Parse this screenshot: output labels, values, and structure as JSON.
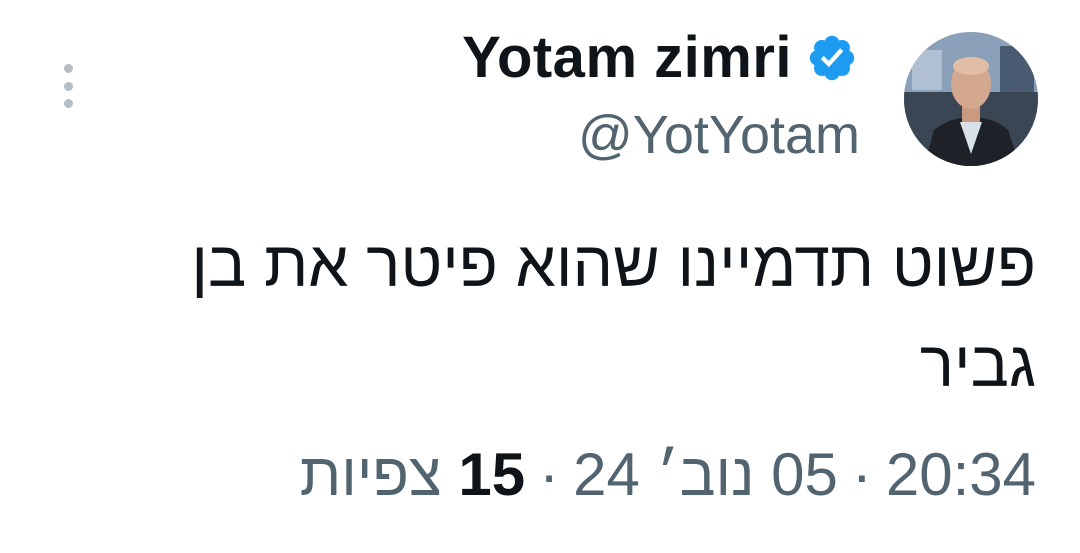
{
  "author": {
    "display_name": "Yotam zimri",
    "handle": "@YotYotam",
    "verified_badge_icon": "verified-badge-icon",
    "avatar_icon": "avatar-photo"
  },
  "menu": {
    "icon": "more-vertical-icon"
  },
  "tweet": {
    "text": "פשוט תדמיינו שהוא פיטר את בן גביר"
  },
  "meta": {
    "time": "20:34",
    "date": "05 נוב׳ 24",
    "separator": "·",
    "views_count": "15",
    "views_label": "צפיות"
  },
  "colors": {
    "text_primary": "#0f1419",
    "text_secondary": "#536471",
    "verified_blue": "#1d9bf0",
    "background": "#ffffff"
  }
}
